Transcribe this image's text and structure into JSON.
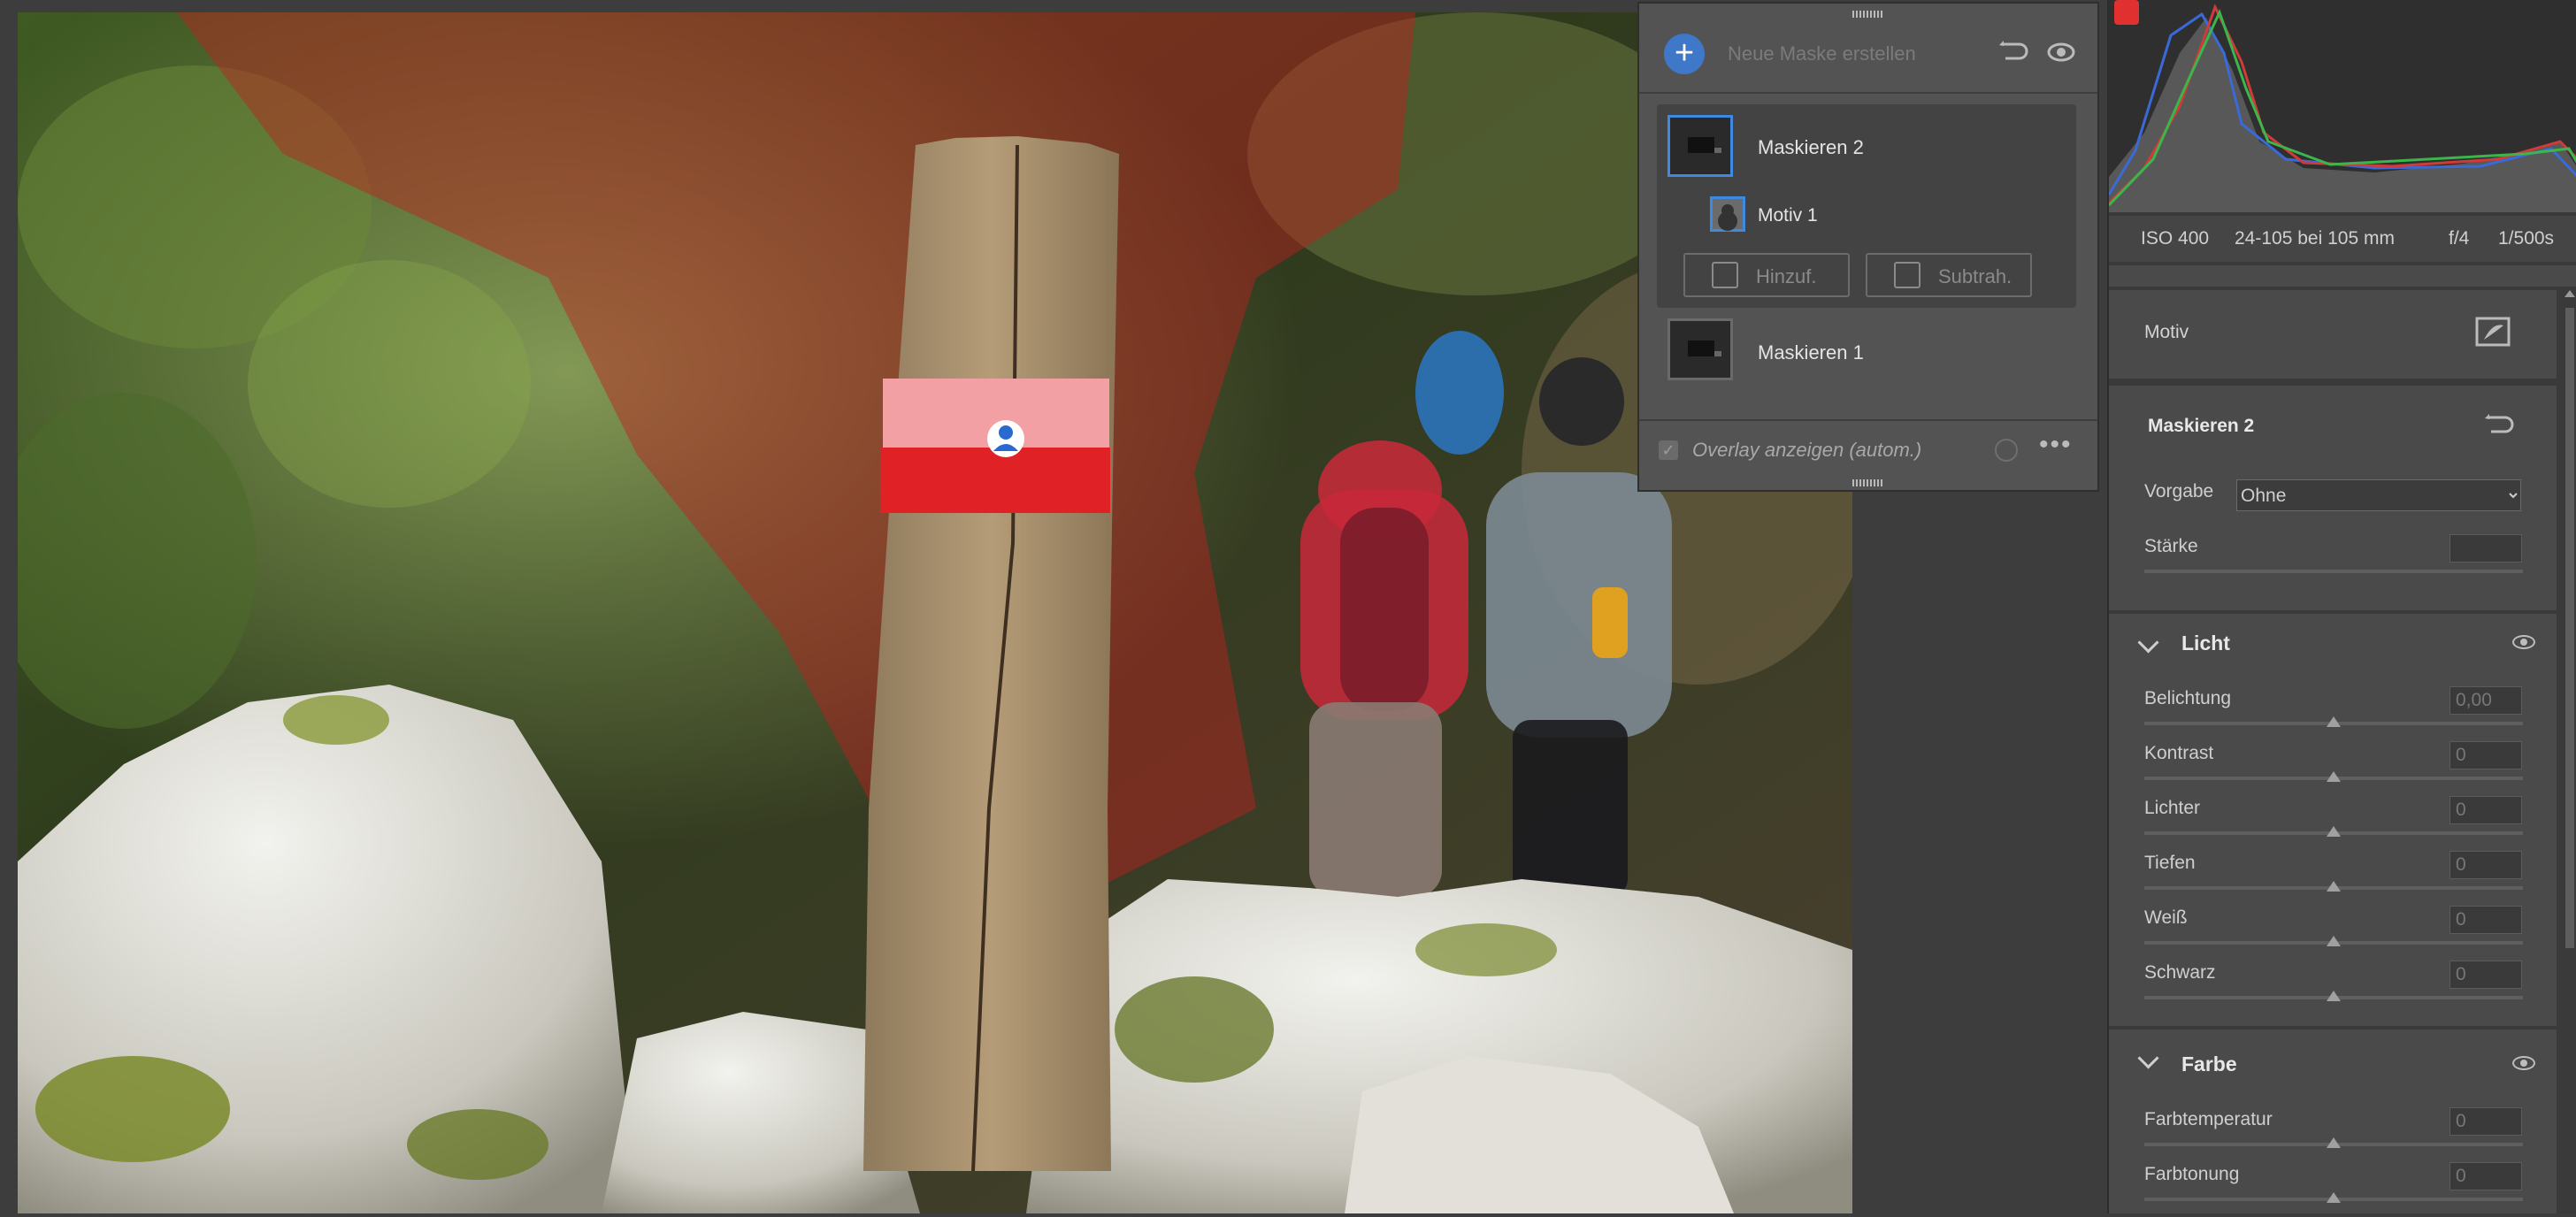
{
  "mask_panel": {
    "new_mask_label": "Neue Maske erstellen",
    "masks": [
      {
        "name": "Maskieren 2",
        "components": [
          {
            "name": "Motiv 1"
          }
        ]
      },
      {
        "name": "Maskieren 1"
      }
    ],
    "add_label": "Hinzuf.",
    "subtract_label": "Subtrah.",
    "overlay_label": "Overlay anzeigen (autom.)",
    "overlay_checked": true
  },
  "exif": {
    "iso": "ISO 400",
    "lens": "24-105 bei 105 mm",
    "aperture": "f/4",
    "shutter": "1/500s"
  },
  "panel": {
    "motiv_label": "Motiv",
    "mask_title": "Maskieren 2",
    "vorgabe_label": "Vorgabe",
    "vorgabe_value": "Ohne",
    "staerke_label": "Stärke",
    "staerke_value": "",
    "licht": {
      "title": "Licht",
      "sliders": [
        {
          "label": "Belichtung",
          "value": "0,00"
        },
        {
          "label": "Kontrast",
          "value": "0"
        },
        {
          "label": "Lichter",
          "value": "0"
        },
        {
          "label": "Tiefen",
          "value": "0"
        },
        {
          "label": "Weiß",
          "value": "0"
        },
        {
          "label": "Schwarz",
          "value": "0"
        }
      ]
    },
    "farbe": {
      "title": "Farbe",
      "sliders": [
        {
          "label": "Farbtemperatur",
          "value": "0"
        },
        {
          "label": "Farbtonung",
          "value": "0"
        }
      ]
    }
  },
  "colors": {
    "accent": "#3f8ae0",
    "overlay_red": "#c0201e",
    "panel_bg": "#4a4a4a"
  }
}
